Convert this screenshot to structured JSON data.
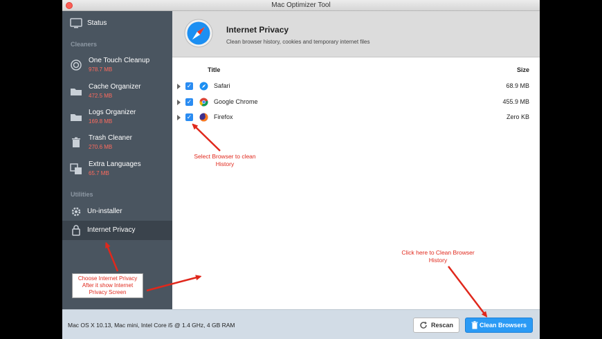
{
  "window": {
    "title": "Mac Optimizer Tool"
  },
  "sidebar": {
    "status_label": "Status",
    "cleaners_header": "Cleaners",
    "cleaners": [
      {
        "label": "One Touch Cleanup",
        "size": "978.7 MB"
      },
      {
        "label": "Cache Organizer",
        "size": "472.5 MB"
      },
      {
        "label": "Logs Organizer",
        "size": "169.8 MB"
      },
      {
        "label": "Trash Cleaner",
        "size": "270.6 MB"
      },
      {
        "label": "Extra Languages",
        "size": "65.7 MB"
      }
    ],
    "utilities_header": "Utilities",
    "utilities": [
      {
        "label": "Un-installer"
      },
      {
        "label": "Internet Privacy"
      }
    ]
  },
  "main": {
    "header_title": "Internet Privacy",
    "header_subtitle": "Clean browser history, cookies and temporary internet files",
    "columns": {
      "title": "Title",
      "size": "Size"
    },
    "browsers": [
      {
        "name": "Safari",
        "size": "68.9 MB",
        "checked": true
      },
      {
        "name": "Google Chrome",
        "size": "455.9 MB",
        "checked": true
      },
      {
        "name": "Firefox",
        "size": "Zero KB",
        "checked": true
      }
    ]
  },
  "statusbar": {
    "system_info": "Mac OS X 10.13, Mac mini, Intel Core i5 @ 1.4 GHz, 4 GB RAM",
    "rescan_label": "Rescan",
    "clean_label": "Clean Browsers"
  },
  "annotations": {
    "select_line1": "Select Browser to clean",
    "select_line2": "History",
    "choose_line1": "Choose Internet Privacy",
    "choose_line2": "After it show Internet",
    "choose_line3": "Privacy Screen",
    "click_line1": "Click here to Clean Browser",
    "click_line2": "History"
  },
  "colors": {
    "sidebar_bg": "#4a5560",
    "accent": "#2a9af5",
    "size_red": "#ff6b5e",
    "annotation_red": "#e0281c"
  }
}
